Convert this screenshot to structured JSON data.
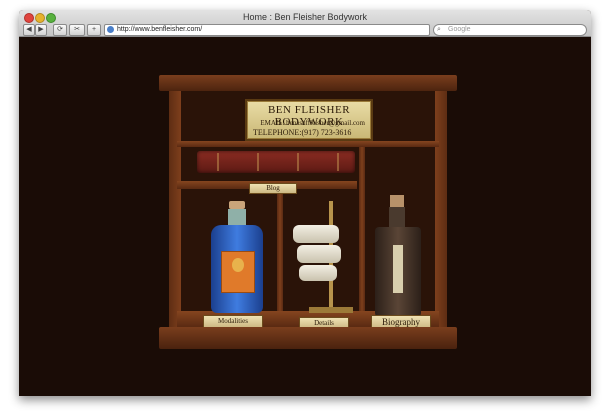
{
  "window": {
    "title": "Home : Ben Fleisher Bodywork"
  },
  "toolbar": {
    "back_glyph": "◀",
    "forward_glyph": "▶",
    "reload_glyph": "⟳",
    "bookmarks_glyph": "✂",
    "add_glyph": "+",
    "url": "http://www.benfleisher.com/",
    "search_placeholder": "Google"
  },
  "nameplate": {
    "title": "BEN FLEISHER BODYWORK",
    "email": "EMAIL: benasuffleisher@gmail.com",
    "phone": "TELEPHONE:(917) 723-3616"
  },
  "labels": {
    "blog": "Blog",
    "modalities": "Modalities",
    "details": "Details",
    "biography": "Biography"
  },
  "colors": {
    "page_background": "#1a0c06",
    "wood": "#7a3e1d",
    "brass_label": "#e3d49b"
  },
  "icons": [
    "back-arrow-icon",
    "forward-arrow-icon",
    "reload-icon",
    "bookmarks-icon",
    "add-tab-icon",
    "globe-icon",
    "search-icon"
  ]
}
